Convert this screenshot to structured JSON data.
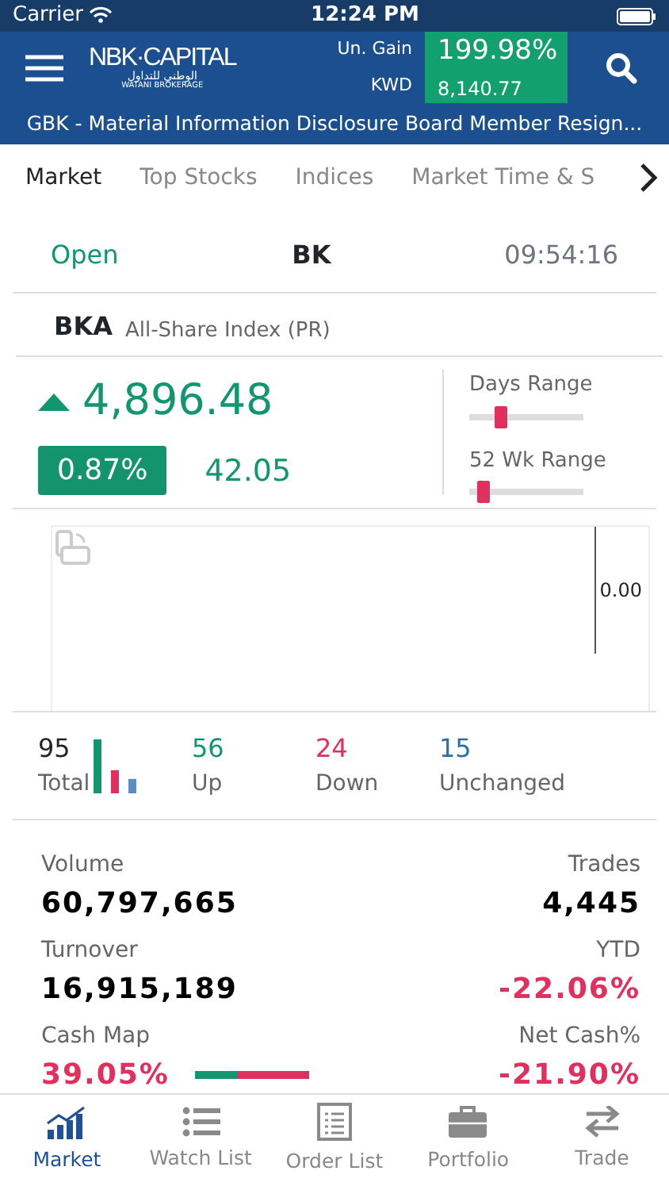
{
  "status_bar": {
    "carrier": "Carrier",
    "time": "12:24 PM"
  },
  "header": {
    "logo": {
      "title": "NBK·CAPITAL",
      "arabic": "الوطني للتداول",
      "subtitle": "WATANI BROKERAGE"
    },
    "gain_label": "Un. Gain",
    "gain_value": "199.98%",
    "currency": "KWD",
    "amount": "8,140.77"
  },
  "ticker": "GBK - Material Information Disclosure Board Member Resign...",
  "tabs": [
    {
      "label": "Market",
      "selected": true
    },
    {
      "label": "Top Stocks",
      "selected": false
    },
    {
      "label": "Indices",
      "selected": false
    },
    {
      "label": "Market Time & S",
      "selected": false
    }
  ],
  "market_status": {
    "state": "Open",
    "exchange": "BK",
    "time": "09:54:16"
  },
  "index": {
    "code": "BKA",
    "name": "All-Share Index (PR)",
    "value": "4,896.48",
    "change_percent": "0.87%",
    "change": "42.05",
    "kind": "up"
  },
  "ranges": [
    {
      "label": "Days Range",
      "level": 0.25
    },
    {
      "label": "52 Wk Range",
      "level": 0.08
    }
  ],
  "chart": {
    "axis_label": "0.00"
  },
  "counts": [
    {
      "kind": "total",
      "value": "95",
      "label": "Total"
    },
    {
      "kind": "up",
      "value": "56",
      "label": "Up"
    },
    {
      "kind": "down",
      "value": "24",
      "label": "Down"
    },
    {
      "kind": "unchanged",
      "value": "15",
      "label": "Unchanged"
    }
  ],
  "stats": [
    {
      "label": "Volume",
      "value": "60,797,665",
      "kind": "plain"
    },
    {
      "label": "Trades",
      "value": "4,445",
      "kind": "plain"
    },
    {
      "label": "Turnover",
      "value": "16,915,189",
      "kind": "plain"
    },
    {
      "label": "YTD",
      "value": "-22.06%",
      "kind": "negative"
    },
    {
      "label": "Cash Map",
      "value": "39.05%",
      "kind": "meter",
      "level": 0.37
    },
    {
      "label": "Net Cash%",
      "value": "-21.90%",
      "kind": "negative"
    }
  ],
  "bottom_nav": [
    {
      "label": "Market",
      "selected": true
    },
    {
      "label": "Watch List",
      "selected": false
    },
    {
      "label": "Order List",
      "selected": false
    },
    {
      "label": "Portfolio",
      "selected": false
    },
    {
      "label": "Trade",
      "selected": false
    }
  ]
}
